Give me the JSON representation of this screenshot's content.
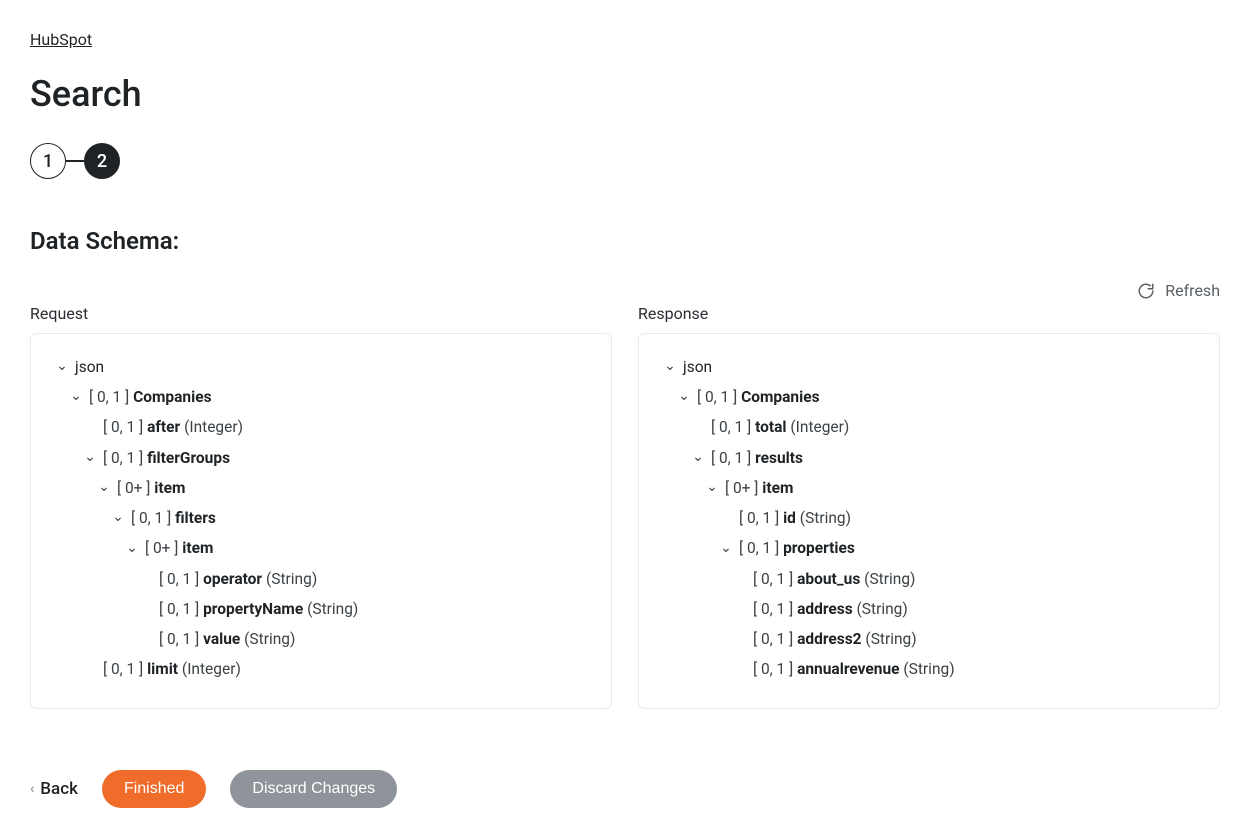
{
  "breadcrumb": {
    "link_label": "HubSpot"
  },
  "page": {
    "title": "Search"
  },
  "steps": {
    "s1": "1",
    "s2": "2",
    "active_index": 2
  },
  "section": {
    "heading": "Data Schema:"
  },
  "refresh": {
    "label": "Refresh"
  },
  "columns": {
    "request_label": "Request",
    "response_label": "Response"
  },
  "request_tree": [
    {
      "indent": 0,
      "expandable": true,
      "card": "",
      "name": "json",
      "type": ""
    },
    {
      "indent": 1,
      "expandable": true,
      "card": "[ 0, 1 ]",
      "name": "Companies",
      "type": ""
    },
    {
      "indent": 2,
      "expandable": false,
      "card": "[ 0, 1 ]",
      "name": "after",
      "type": "(Integer)"
    },
    {
      "indent": 2,
      "expandable": true,
      "card": "[ 0, 1 ]",
      "name": "filterGroups",
      "type": ""
    },
    {
      "indent": 3,
      "expandable": true,
      "card": "[ 0+ ]",
      "name": "item",
      "type": ""
    },
    {
      "indent": 4,
      "expandable": true,
      "card": "[ 0, 1 ]",
      "name": "filters",
      "type": ""
    },
    {
      "indent": 5,
      "expandable": true,
      "card": "[ 0+ ]",
      "name": "item",
      "type": ""
    },
    {
      "indent": 6,
      "expandable": false,
      "card": "[ 0, 1 ]",
      "name": "operator",
      "type": "(String)"
    },
    {
      "indent": 6,
      "expandable": false,
      "card": "[ 0, 1 ]",
      "name": "propertyName",
      "type": "(String)"
    },
    {
      "indent": 6,
      "expandable": false,
      "card": "[ 0, 1 ]",
      "name": "value",
      "type": "(String)"
    },
    {
      "indent": 2,
      "expandable": false,
      "card": "[ 0, 1 ]",
      "name": "limit",
      "type": "(Integer)"
    }
  ],
  "response_tree": [
    {
      "indent": 0,
      "expandable": true,
      "card": "",
      "name": "json",
      "type": ""
    },
    {
      "indent": 1,
      "expandable": true,
      "card": "[ 0, 1 ]",
      "name": "Companies",
      "type": ""
    },
    {
      "indent": 2,
      "expandable": false,
      "card": "[ 0, 1 ]",
      "name": "total",
      "type": "(Integer)"
    },
    {
      "indent": 2,
      "expandable": true,
      "card": "[ 0, 1 ]",
      "name": "results",
      "type": ""
    },
    {
      "indent": 3,
      "expandable": true,
      "card": "[ 0+ ]",
      "name": "item",
      "type": ""
    },
    {
      "indent": 4,
      "expandable": false,
      "card": "[ 0, 1 ]",
      "name": "id",
      "type": "(String)"
    },
    {
      "indent": 4,
      "expandable": true,
      "card": "[ 0, 1 ]",
      "name": "properties",
      "type": ""
    },
    {
      "indent": 5,
      "expandable": false,
      "card": "[ 0, 1 ]",
      "name": "about_us",
      "type": "(String)"
    },
    {
      "indent": 5,
      "expandable": false,
      "card": "[ 0, 1 ]",
      "name": "address",
      "type": "(String)"
    },
    {
      "indent": 5,
      "expandable": false,
      "card": "[ 0, 1 ]",
      "name": "address2",
      "type": "(String)"
    },
    {
      "indent": 5,
      "expandable": false,
      "card": "[ 0, 1 ]",
      "name": "annualrevenue",
      "type": "(String)"
    }
  ],
  "footer": {
    "back_label": "Back",
    "finished_label": "Finished",
    "discard_label": "Discard Changes"
  },
  "chevron_glyph": "⌄"
}
